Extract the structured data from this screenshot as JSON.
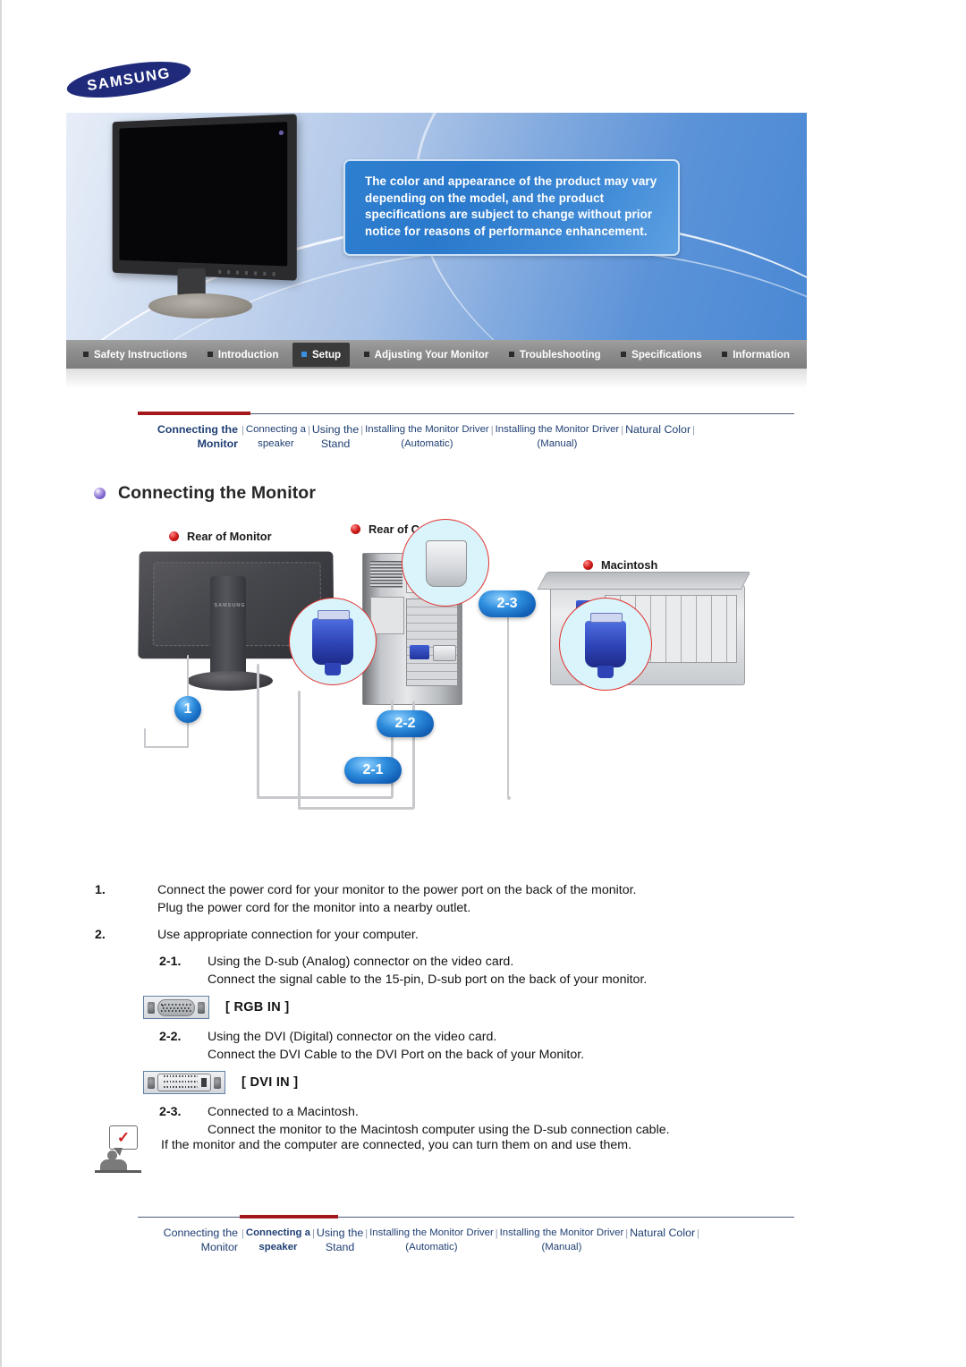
{
  "brand": {
    "logo_text": "SAMSUNG"
  },
  "hero": {
    "notice": "The color and appearance of the product may vary depending on the model, and the product specifications are subject to change without prior notice for reasons of performance enhancement.",
    "monitor_alt": "samsung-lcd-monitor"
  },
  "main_nav": {
    "items": [
      {
        "label": "Safety Instructions",
        "active": false
      },
      {
        "label": "Introduction",
        "active": false
      },
      {
        "label": "Setup",
        "active": true
      },
      {
        "label": "Adjusting Your Monitor",
        "active": false
      },
      {
        "label": "Troubleshooting",
        "active": false
      },
      {
        "label": "Specifications",
        "active": false
      },
      {
        "label": "Information",
        "active": false
      }
    ]
  },
  "sub_nav_top": {
    "items": [
      {
        "line1": "Connecting  the",
        "line2": "Monitor",
        "current": true
      },
      {
        "line1": "Connecting a",
        "line2": "speaker",
        "current": false
      },
      {
        "line1": "Using the",
        "line2": "Stand",
        "current": false
      },
      {
        "line1": "Installing the Monitor Driver",
        "line2": "(Automatic)",
        "current": false
      },
      {
        "line1": "Installing the Monitor Driver",
        "line2": "(Manual)",
        "current": false
      },
      {
        "line1": "Natural Color",
        "line2": "",
        "current": false
      }
    ]
  },
  "sub_nav_bottom": {
    "items": [
      {
        "line1": "Connecting  the",
        "line2": "Monitor",
        "current": false
      },
      {
        "line1": "Connecting a",
        "line2": "speaker",
        "current": true
      },
      {
        "line1": "Using the",
        "line2": "Stand",
        "current": false
      },
      {
        "line1": "Installing the Monitor Driver",
        "line2": "(Automatic)",
        "current": false
      },
      {
        "line1": "Installing the Monitor Driver",
        "line2": "(Manual)",
        "current": false
      },
      {
        "line1": "Natural Color",
        "line2": "",
        "current": false
      }
    ]
  },
  "section": {
    "title": "Connecting the Monitor"
  },
  "diagram": {
    "label_monitor": "Rear of Monitor",
    "label_computer": "Rear of Computer",
    "label_macintosh": "Macintosh",
    "badges": {
      "one": "1",
      "two_one": "2-1",
      "two_two": "2-2",
      "two_three": "2-3"
    }
  },
  "steps": {
    "step1_num": "1.",
    "step1_line1": "Connect the power cord for your monitor to the power port on the back of the monitor.",
    "step1_line2": "Plug the power cord for the monitor into a nearby outlet.",
    "step2_num": "2.",
    "step2_text": "Use appropriate connection for your computer.",
    "step21_num": "2-1.",
    "step21_line1": "Using the D-sub (Analog) connector on the video card.",
    "step21_line2": "Connect the signal cable to the 15-pin, D-sub port on the back of your monitor.",
    "rgb_label": "[ RGB IN ]",
    "step22_num": "2-2.",
    "step22_line1": "Using the DVI (Digital) connector on the video card.",
    "step22_line2": "Connect the DVI Cable to the DVI Port on the back of your Monitor.",
    "dvi_label": "[ DVI IN ]",
    "step23_num": "2-3.",
    "step23_line1": "Connected to a Macintosh.",
    "step23_line2": "Connect the monitor to the Macintosh computer using the D-sub connection cable."
  },
  "note": {
    "check_mark": "✓",
    "text": "If the monitor and the computer are connected, you can turn them on and use them."
  },
  "colors": {
    "accent_red": "#a3191b",
    "nav_link": "#1f3f73",
    "badge_blue": "#1262b9",
    "brand_navy": "#1f2a7a"
  }
}
